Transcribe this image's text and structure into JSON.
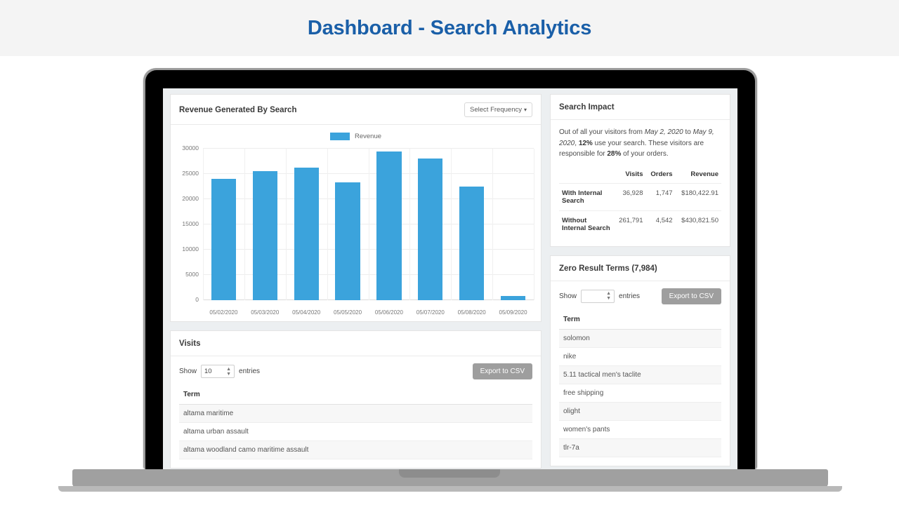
{
  "header": {
    "title": "Dashboard - Search Analytics"
  },
  "colors": {
    "accent": "#3ba3dc",
    "title": "#1a5fa8",
    "csv_button": "#9e9e9e"
  },
  "revenue_card": {
    "title": "Revenue Generated By Search",
    "frequency_button": "Select Frequency",
    "caret": "▾"
  },
  "visits_card": {
    "title": "Visits",
    "show_label": "Show",
    "entries_label": "entries",
    "entries_value": "10",
    "export_label": "Export to CSV",
    "columns": [
      "Term"
    ],
    "rows": [
      [
        "altama maritime"
      ],
      [
        "altama urban assault"
      ],
      [
        "altama woodland camo maritime assault"
      ]
    ]
  },
  "search_impact": {
    "title": "Search Impact",
    "summary": {
      "pre": "Out of all your visitors from ",
      "date_from": "May 2, 2020",
      "mid1": " to ",
      "date_to": "May 9, 2020",
      "mid2": ", ",
      "pct_use_search": "12%",
      "mid3": " use your search. These visitors are responsible for ",
      "pct_orders": "28%",
      "post": " of your orders."
    },
    "columns": [
      "",
      "Visits",
      "Orders",
      "Revenue"
    ],
    "rows": [
      {
        "label": "With Internal Search",
        "visits": "36,928",
        "orders": "1,747",
        "revenue": "$180,422.91"
      },
      {
        "label": "Without Internal Search",
        "visits": "261,791",
        "orders": "4,542",
        "revenue": "$430,821.50"
      }
    ]
  },
  "zero_result_card": {
    "title": "Zero Result Terms (7,984)",
    "show_label": "Show",
    "entries_label": "entries",
    "entries_value": "",
    "export_label": "Export to CSV",
    "columns": [
      "Term"
    ],
    "rows": [
      [
        "solomon"
      ],
      [
        "nike"
      ],
      [
        "5.11 tactical men's taclite"
      ],
      [
        "free shipping"
      ],
      [
        "olight"
      ],
      [
        "women's pants"
      ],
      [
        "tlr-7a"
      ]
    ]
  },
  "chart_data": {
    "type": "bar",
    "title": "Revenue Generated By Search",
    "xlabel": "",
    "ylabel": "",
    "categories": [
      "05/02/2020",
      "05/03/2020",
      "05/04/2020",
      "05/05/2020",
      "05/06/2020",
      "05/07/2020",
      "05/08/2020",
      "05/09/2020"
    ],
    "series": [
      {
        "name": "Revenue",
        "color": "#3ba3dc",
        "values": [
          24000,
          25600,
          26300,
          23300,
          29400,
          28100,
          22500,
          800
        ]
      }
    ],
    "legend": [
      "Revenue"
    ],
    "legend_position": "top-center",
    "yticks": [
      0,
      5000,
      10000,
      15000,
      20000,
      25000,
      30000
    ],
    "ytick_labels": [
      "0",
      "5000",
      "10000",
      "15000",
      "20000",
      "25000",
      "30000"
    ],
    "ylim": [
      0,
      30000
    ],
    "grid": true
  }
}
